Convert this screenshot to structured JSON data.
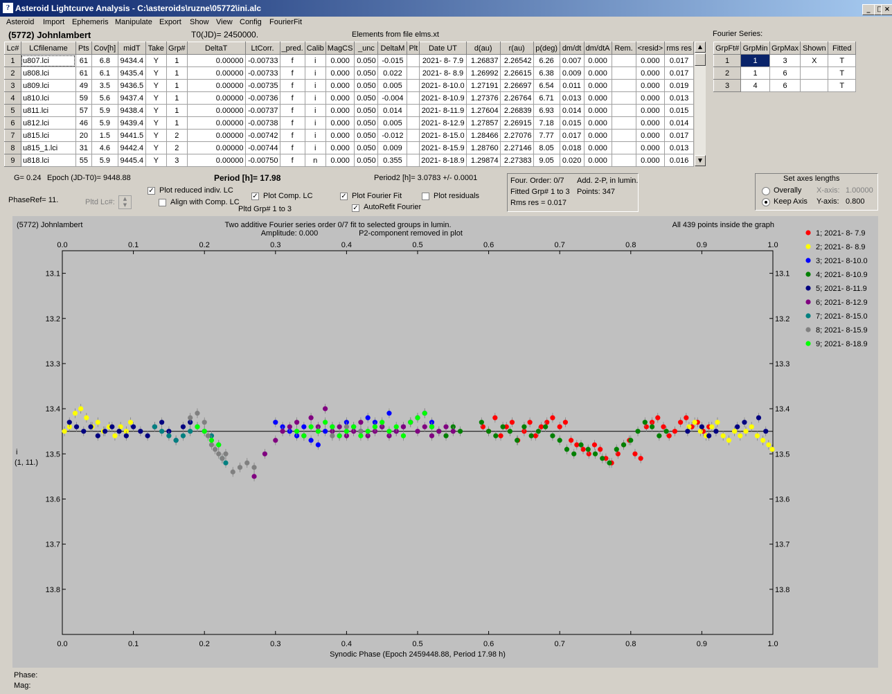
{
  "window": {
    "title": "Asteroid Lightcurve Analysis - C:\\asteroids\\ruzne\\05772\\ini.alc",
    "icon_name": "app-icon",
    "minimize_icon": "minimize-icon",
    "maximize_icon": "maximize-icon",
    "close_icon": "close-icon"
  },
  "menu": [
    "Asteroid",
    "Import",
    "Ephemeris",
    "Manipulate",
    "Export",
    "Show",
    "View",
    "Config",
    "FourierFit"
  ],
  "header": {
    "asteroid": "(5772) Johnlambert",
    "t0": "T0(JD)= 2450000.",
    "elements": "Elements from file elms.xt",
    "fourier_series_label": "Fourier Series:"
  },
  "lc_table": {
    "columns": [
      "Lc#",
      "LCfilename",
      "Pts",
      "Cov[h]",
      "midT",
      "Take",
      "Grp#",
      "DeltaT",
      "LtCorr.",
      "_pred.",
      "Calib",
      "MagCS",
      "_unc",
      "DeltaM",
      "Plt",
      "Date UT",
      "d(au)",
      "r(au)",
      "p(deg)",
      "dm/dt",
      "dm/dtA",
      "Rem.",
      "<resid>",
      "rms res"
    ],
    "rows": [
      [
        "1",
        "u807.lci",
        "61",
        "6.8",
        "9434.4",
        "Y",
        "1",
        "0.00000",
        "-0.00733",
        "f",
        "i",
        "0.000",
        "0.050",
        "-0.015",
        "",
        "2021- 8- 7.9",
        "1.26837",
        "2.26542",
        "6.26",
        "0.007",
        "0.000",
        "",
        "0.000",
        "0.017"
      ],
      [
        "2",
        "u808.lci",
        "61",
        "6.1",
        "9435.4",
        "Y",
        "1",
        "0.00000",
        "-0.00733",
        "f",
        "i",
        "0.000",
        "0.050",
        "0.022",
        "",
        "2021- 8- 8.9",
        "1.26992",
        "2.26615",
        "6.38",
        "0.009",
        "0.000",
        "",
        "0.000",
        "0.017"
      ],
      [
        "3",
        "u809.lci",
        "49",
        "3.5",
        "9436.5",
        "Y",
        "1",
        "0.00000",
        "-0.00735",
        "f",
        "i",
        "0.000",
        "0.050",
        "0.005",
        "",
        "2021- 8-10.0",
        "1.27191",
        "2.26697",
        "6.54",
        "0.011",
        "0.000",
        "",
        "0.000",
        "0.019"
      ],
      [
        "4",
        "u810.lci",
        "59",
        "5.6",
        "9437.4",
        "Y",
        "1",
        "0.00000",
        "-0.00736",
        "f",
        "i",
        "0.000",
        "0.050",
        "-0.004",
        "",
        "2021- 8-10.9",
        "1.27376",
        "2.26764",
        "6.71",
        "0.013",
        "0.000",
        "",
        "0.000",
        "0.013"
      ],
      [
        "5",
        "u811.lci",
        "57",
        "5.9",
        "9438.4",
        "Y",
        "1",
        "0.00000",
        "-0.00737",
        "f",
        "i",
        "0.000",
        "0.050",
        "0.014",
        "",
        "2021- 8-11.9",
        "1.27604",
        "2.26839",
        "6.93",
        "0.014",
        "0.000",
        "",
        "0.000",
        "0.015"
      ],
      [
        "6",
        "u812.lci",
        "46",
        "5.9",
        "9439.4",
        "Y",
        "1",
        "0.00000",
        "-0.00738",
        "f",
        "i",
        "0.000",
        "0.050",
        "0.005",
        "",
        "2021- 8-12.9",
        "1.27857",
        "2.26915",
        "7.18",
        "0.015",
        "0.000",
        "",
        "0.000",
        "0.014"
      ],
      [
        "7",
        "u815.lci",
        "20",
        "1.5",
        "9441.5",
        "Y",
        "2",
        "0.00000",
        "-0.00742",
        "f",
        "i",
        "0.000",
        "0.050",
        "-0.012",
        "",
        "2021- 8-15.0",
        "1.28466",
        "2.27076",
        "7.77",
        "0.017",
        "0.000",
        "",
        "0.000",
        "0.017"
      ],
      [
        "8",
        "u815_1.lci",
        "31",
        "4.6",
        "9442.4",
        "Y",
        "2",
        "0.00000",
        "-0.00744",
        "f",
        "i",
        "0.000",
        "0.050",
        "0.009",
        "",
        "2021- 8-15.9",
        "1.28760",
        "2.27146",
        "8.05",
        "0.018",
        "0.000",
        "",
        "0.000",
        "0.013"
      ],
      [
        "9",
        "u818.lci",
        "55",
        "5.9",
        "9445.4",
        "Y",
        "3",
        "0.00000",
        "-0.00750",
        "f",
        "n",
        "0.000",
        "0.050",
        "0.355",
        "",
        "2021- 8-18.9",
        "1.29874",
        "2.27383",
        "9.05",
        "0.020",
        "0.000",
        "",
        "0.000",
        "0.016"
      ]
    ]
  },
  "fourier_table": {
    "columns": [
      "GrpFt#",
      "GrpMin",
      "GrpMax",
      "Shown",
      "Fitted"
    ],
    "rows": [
      [
        "1",
        "1",
        "3",
        "X",
        "T"
      ],
      [
        "2",
        "1",
        "6",
        "",
        "T"
      ],
      [
        "3",
        "4",
        "6",
        "",
        "T"
      ]
    ]
  },
  "controls": {
    "g": "G= 0.24",
    "epoch": "Epoch (JD-T0)= 9448.88",
    "period": "Period [h]= 17.98",
    "period2": "Period2 [h]= 3.0783 +/- 0.0001",
    "phaseref": "PhaseRef= 11.",
    "pltd_lc": "Pltd Lc#:",
    "plot_reduced": {
      "label": "Plot reduced indiv. LC",
      "checked": true
    },
    "align": {
      "label": "Align with Comp. LC",
      "checked": false
    },
    "plot_comp": {
      "label": "Plot Comp. LC",
      "checked": true
    },
    "pltd_grp": "Pltd Grp#  1   to   3",
    "plot_fourier": {
      "label": "Plot Fourier Fit",
      "checked": true
    },
    "autorefit": {
      "label": "AutoRefit Fourier",
      "checked": true
    },
    "plot_residuals": {
      "label": "Plot residuals",
      "checked": false
    },
    "four_order": "Four. Order:  0/7",
    "add2p": "Add. 2-P, in lumin.",
    "fitted_grp": "Fitted Grp# 1 to 3",
    "points": "Points: 347",
    "rms": "Rms res     = 0.017",
    "axes_title": "Set axes lengths",
    "overally": "Overally",
    "keep_axis": "Keep Axis",
    "xaxis_label": "X-axis:",
    "xaxis_value": "1.00000",
    "yaxis_label": "Y-axis:",
    "yaxis_value": "0.800",
    "axes_mode": "Keep Axis"
  },
  "status": {
    "phase": "Phase:",
    "mag": "Mag:"
  },
  "chart_data": {
    "type": "scatter",
    "title_left": "(5772) Johnlambert",
    "title_center1": "Two additive Fourier series order 0/7 fit to selected groups in lumin.",
    "title_center2a": "Amplitude: 0.000",
    "title_center2b": "P2-component removed in plot",
    "title_right": "All 439 points inside the graph",
    "xlabel": "Synodic Phase (Epoch 2459448.88, Period 17.98 h)",
    "ylabel": "i",
    "ylabel2": "(1, 11.)",
    "xlim": [
      0.0,
      1.0
    ],
    "ylim": [
      13.05,
      13.9
    ],
    "y_inverted": true,
    "x_ticks": [
      "0.0",
      "0.1",
      "0.2",
      "0.3",
      "0.4",
      "0.5",
      "0.6",
      "0.7",
      "0.8",
      "0.9",
      "1.0"
    ],
    "y_ticks": [
      "13.1",
      "13.2",
      "13.3",
      "13.4",
      "13.5",
      "13.6",
      "13.7",
      "13.8"
    ],
    "fit_line_y": 13.45,
    "grid": false,
    "legend_position": "right",
    "series": [
      {
        "name": "1; 2021- 8- 7.9",
        "color": "#ff0000",
        "x": [
          0.592,
          0.6,
          0.609,
          0.617,
          0.625,
          0.633,
          0.641,
          0.65,
          0.658,
          0.666,
          0.674,
          0.682,
          0.69,
          0.7,
          0.708,
          0.716,
          0.724,
          0.733,
          0.741,
          0.749,
          0.757,
          0.765,
          0.773,
          0.782,
          0.79,
          0.798,
          0.806,
          0.814,
          0.822,
          0.83,
          0.838,
          0.846,
          0.854,
          0.862,
          0.87,
          0.878,
          0.886,
          0.894,
          0.902,
          0.91
        ],
        "y": [
          13.44,
          13.45,
          13.42,
          13.46,
          13.44,
          13.43,
          13.47,
          13.45,
          13.43,
          13.46,
          13.44,
          13.43,
          13.42,
          13.44,
          13.43,
          13.47,
          13.48,
          13.49,
          13.5,
          13.48,
          13.49,
          13.51,
          13.52,
          13.5,
          13.48,
          13.47,
          13.5,
          13.51,
          13.44,
          13.43,
          13.42,
          13.44,
          13.46,
          13.45,
          13.43,
          13.42,
          13.44,
          13.43,
          13.45,
          13.44
        ]
      },
      {
        "name": "2; 2021- 8- 8.9",
        "color": "#ffff00",
        "x": [
          0.003,
          0.01,
          0.018,
          0.026,
          0.034,
          0.042,
          0.05,
          0.058,
          0.066,
          0.074,
          0.082,
          0.09,
          0.096,
          0.882,
          0.89,
          0.898,
          0.906,
          0.914,
          0.922,
          0.93,
          0.938,
          0.946,
          0.954,
          0.962,
          0.97,
          0.978,
          0.986,
          0.994,
          0.999
        ],
        "y": [
          13.45,
          13.44,
          13.41,
          13.4,
          13.42,
          13.44,
          13.43,
          13.45,
          13.44,
          13.46,
          13.44,
          13.45,
          13.43,
          13.44,
          13.43,
          13.45,
          13.46,
          13.44,
          13.43,
          13.46,
          13.47,
          13.45,
          13.46,
          13.45,
          13.44,
          13.46,
          13.47,
          13.48,
          13.49
        ]
      },
      {
        "name": "3; 2021- 8-10.0",
        "color": "#0000ff",
        "x": [
          0.3,
          0.31,
          0.32,
          0.33,
          0.34,
          0.35,
          0.36,
          0.37,
          0.38,
          0.39,
          0.4,
          0.41,
          0.42,
          0.43,
          0.44,
          0.45,
          0.46,
          0.47,
          0.48,
          0.49,
          0.5,
          0.51,
          0.52
        ],
        "y": [
          13.43,
          13.44,
          13.45,
          13.46,
          13.44,
          13.47,
          13.48,
          13.45,
          13.44,
          13.46,
          13.43,
          13.44,
          13.45,
          13.42,
          13.43,
          13.44,
          13.41,
          13.45,
          13.44,
          13.43,
          13.42,
          13.41,
          13.43
        ]
      },
      {
        "name": "4; 2021- 8-10.9",
        "color": "#008000",
        "x": [
          0.52,
          0.53,
          0.54,
          0.55,
          0.56,
          0.59,
          0.6,
          0.61,
          0.62,
          0.63,
          0.64,
          0.65,
          0.66,
          0.67,
          0.68,
          0.69,
          0.7,
          0.71,
          0.72,
          0.73,
          0.74,
          0.75,
          0.76,
          0.77,
          0.78,
          0.79,
          0.8,
          0.81,
          0.82,
          0.83,
          0.84,
          0.85
        ],
        "y": [
          13.44,
          13.45,
          13.46,
          13.44,
          13.45,
          13.43,
          13.45,
          13.46,
          13.44,
          13.45,
          13.47,
          13.44,
          13.46,
          13.45,
          13.44,
          13.46,
          13.47,
          13.49,
          13.5,
          13.48,
          13.49,
          13.5,
          13.51,
          13.52,
          13.49,
          13.48,
          13.47,
          13.45,
          13.43,
          13.44,
          13.46,
          13.45
        ]
      },
      {
        "name": "5; 2021- 8-11.9",
        "color": "#000080",
        "x": [
          0.01,
          0.02,
          0.03,
          0.04,
          0.05,
          0.06,
          0.07,
          0.08,
          0.09,
          0.1,
          0.11,
          0.12,
          0.13,
          0.14,
          0.15,
          0.16,
          0.17,
          0.18,
          0.88,
          0.9,
          0.91,
          0.92,
          0.95,
          0.96,
          0.98,
          0.99
        ],
        "y": [
          13.43,
          13.44,
          13.45,
          13.44,
          13.46,
          13.45,
          13.44,
          13.45,
          13.46,
          13.44,
          13.45,
          13.46,
          13.44,
          13.43,
          13.45,
          13.47,
          13.44,
          13.43,
          13.45,
          13.44,
          13.46,
          13.45,
          13.44,
          13.43,
          13.42,
          13.45
        ]
      },
      {
        "name": "6; 2021- 8-12.9",
        "color": "#800080",
        "x": [
          0.27,
          0.285,
          0.3,
          0.31,
          0.32,
          0.33,
          0.34,
          0.35,
          0.36,
          0.37,
          0.38,
          0.39,
          0.4,
          0.41,
          0.42,
          0.43,
          0.44,
          0.45,
          0.46,
          0.47,
          0.48,
          0.49,
          0.5,
          0.51,
          0.52,
          0.53,
          0.54,
          0.55
        ],
        "y": [
          13.55,
          13.5,
          13.47,
          13.45,
          13.44,
          13.43,
          13.46,
          13.42,
          13.44,
          13.4,
          13.45,
          13.44,
          13.46,
          13.45,
          13.43,
          13.46,
          13.45,
          13.44,
          13.46,
          13.45,
          13.44,
          13.43,
          13.45,
          13.44,
          13.46,
          13.45,
          13.44,
          13.45
        ]
      },
      {
        "name": "7; 2021- 8-15.0",
        "color": "#008080",
        "x": [
          0.13,
          0.14,
          0.15,
          0.16,
          0.17,
          0.18,
          0.19,
          0.2,
          0.21,
          0.22,
          0.225,
          0.23
        ],
        "y": [
          13.44,
          13.45,
          13.46,
          13.47,
          13.46,
          13.45,
          13.44,
          13.45,
          13.46,
          13.48,
          13.51,
          13.52
        ]
      },
      {
        "name": "8; 2021- 8-15.9",
        "color": "#808080",
        "x": [
          0.18,
          0.19,
          0.2,
          0.205,
          0.21,
          0.215,
          0.22,
          0.225,
          0.23,
          0.24,
          0.25,
          0.26,
          0.27,
          0.36,
          0.38,
          0.4,
          0.42
        ],
        "y": [
          13.42,
          13.41,
          13.43,
          13.46,
          13.48,
          13.49,
          13.5,
          13.51,
          13.5,
          13.54,
          13.53,
          13.52,
          13.53,
          13.45,
          13.46,
          13.44,
          13.45
        ]
      },
      {
        "name": "9; 2021- 8-18.9",
        "color": "#00ff00",
        "x": [
          0.19,
          0.2,
          0.21,
          0.22,
          0.33,
          0.34,
          0.35,
          0.36,
          0.37,
          0.38,
          0.39,
          0.4,
          0.41,
          0.42,
          0.43,
          0.44,
          0.45,
          0.46,
          0.47,
          0.48,
          0.49,
          0.5,
          0.51,
          0.52
        ],
        "y": [
          13.44,
          13.45,
          13.47,
          13.48,
          13.45,
          13.46,
          13.44,
          13.45,
          13.43,
          13.44,
          13.46,
          13.45,
          13.44,
          13.46,
          13.45,
          13.44,
          13.43,
          13.45,
          13.44,
          13.46,
          13.43,
          13.42,
          13.41,
          13.44
        ]
      }
    ]
  }
}
